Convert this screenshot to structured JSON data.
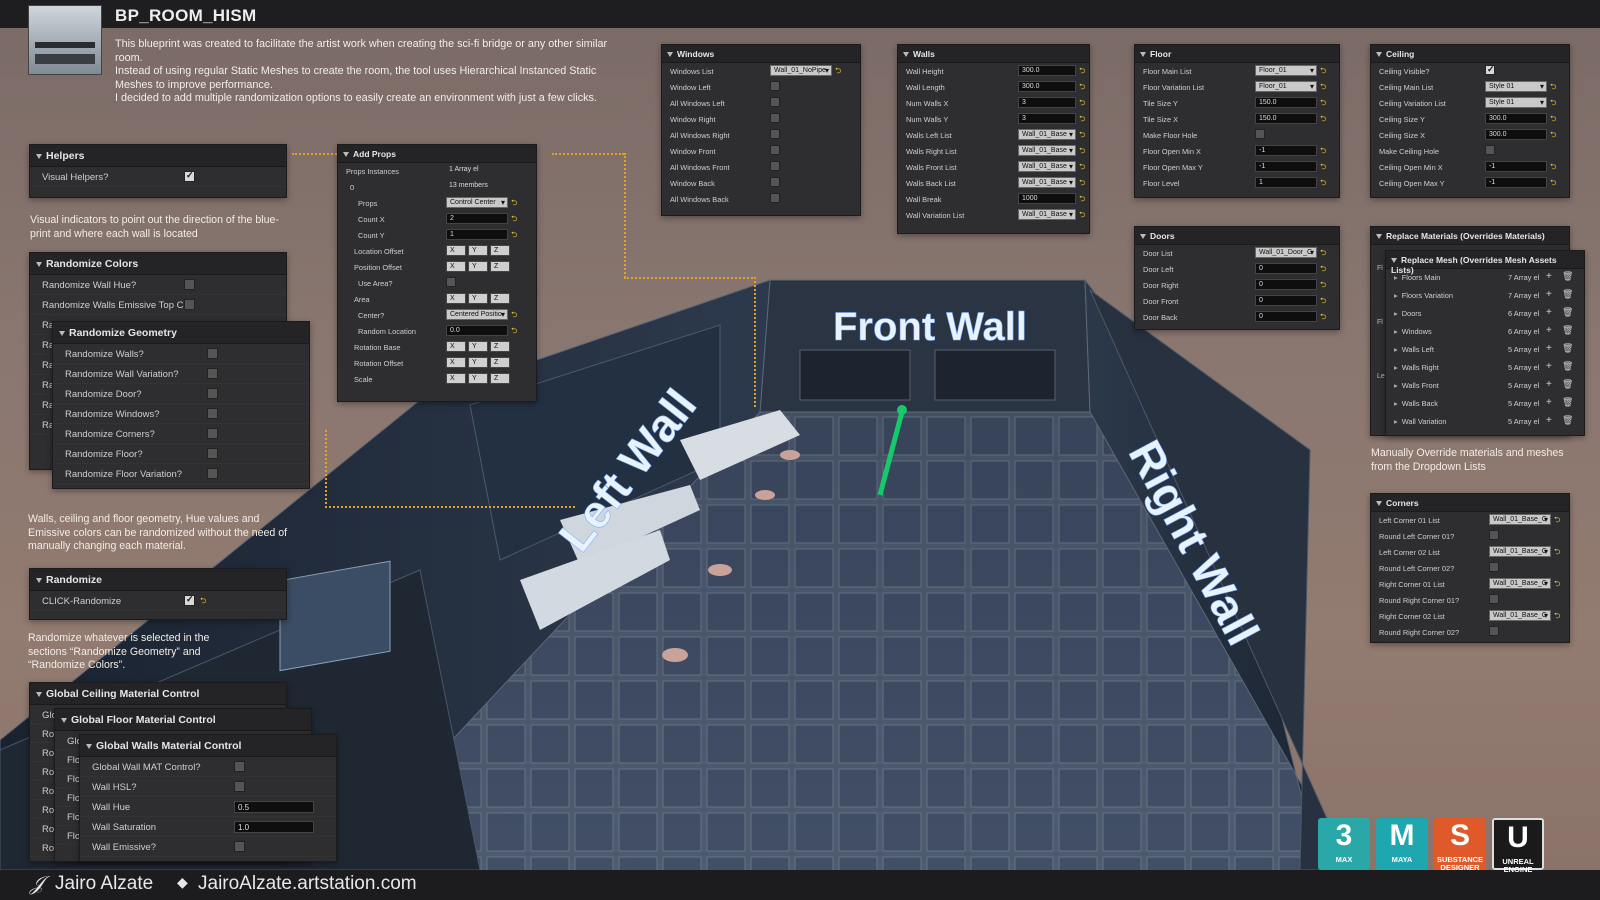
{
  "title": "BP_ROOM_HISM",
  "description": [
    "This blueprint was created to facilitate the artist work when creating the sci-fi bridge or any other similar room.",
    "Instead of using regular Static Meshes to create the room, the tool uses Hierarchical Instanced Static Meshes to improve performance.",
    "I decided to add multiple randomization options to easily create an environment with just a few clicks."
  ],
  "helpers": {
    "title": "Helpers",
    "rows": [
      {
        "label": "Visual Helpers?",
        "checked": true
      }
    ],
    "note": "Visual indicators to point out the direction of the blue-print and where each wall is located"
  },
  "randomize_colors": {
    "title": "Randomize Colors",
    "rows": [
      {
        "label": "Randomize Wall Hue?"
      },
      {
        "label": "Randomize Walls Emissive Top C"
      }
    ]
  },
  "randomize_geometry": {
    "title": "Randomize Geometry",
    "rows": [
      {
        "label": "Randomize Walls?"
      },
      {
        "label": "Randomize Wall Variation?"
      },
      {
        "label": "Randomize Door?"
      },
      {
        "label": "Randomize Windows?"
      },
      {
        "label": "Randomize Corners?"
      },
      {
        "label": "Randomize Floor?"
      },
      {
        "label": "Randomize Floor Variation?"
      }
    ],
    "behind_labels": [
      "Ra",
      "Ra",
      "Ra",
      "Ra",
      "Ra",
      "Ra"
    ]
  },
  "geometry_note": "Walls, ceiling and floor geometry, Hue values and Emissive colors can be randomized without the need of manually changing each material.",
  "randomize": {
    "title": "Randomize",
    "rows": [
      {
        "label": "CLICK-Randomize",
        "checked": true
      }
    ],
    "note": "Randomize whatever is selected in the sections “Randomize Geometry” and “Randomize Colors”."
  },
  "global_ceiling": {
    "title": "Global Ceiling Material Control",
    "behind_labels": [
      "Glo",
      "Ro",
      "Ro",
      "Ro",
      "Ro",
      "Ro",
      "Ro",
      "Ro"
    ]
  },
  "global_floor": {
    "title": "Global Floor Material Control",
    "behind_labels": [
      "Glo",
      "Flo",
      "Flo",
      "Flo",
      "Flo",
      "Flo"
    ]
  },
  "global_walls": {
    "title": "Global Walls Material Control",
    "rows": [
      {
        "label": "Global Wall MAT Control?",
        "type": "check"
      },
      {
        "label": "Wall HSL?",
        "type": "check"
      },
      {
        "label": "Wall Hue",
        "type": "num",
        "value": "0.5"
      },
      {
        "label": "Wall Saturation",
        "type": "num",
        "value": "1.0"
      },
      {
        "label": "Wall Emissive?",
        "type": "check"
      }
    ]
  },
  "add_props": {
    "title": "Add Props",
    "rows": [
      {
        "label": "Props Instances",
        "value": "1 Array el",
        "type": "array"
      },
      {
        "label": "0",
        "value": "13 members",
        "type": "members"
      },
      {
        "label": "Props",
        "value": "Control Center",
        "type": "dd"
      },
      {
        "label": "Count X",
        "value": "2",
        "type": "num"
      },
      {
        "label": "Count Y",
        "value": "1",
        "type": "num"
      },
      {
        "label": "Location Offset",
        "type": "xyz"
      },
      {
        "label": "Position Offset",
        "type": "xyz"
      },
      {
        "label": "Use Area?",
        "type": "check"
      },
      {
        "label": "Area",
        "type": "xyz"
      },
      {
        "label": "Center?",
        "value": "Centered Positio",
        "type": "dd"
      },
      {
        "label": "Random Location",
        "value": "0.0",
        "type": "num"
      },
      {
        "label": "Rotation Base",
        "type": "xyz"
      },
      {
        "label": "Rotation Offset",
        "type": "xyz"
      },
      {
        "label": "Scale",
        "type": "xyz"
      }
    ]
  },
  "windows": {
    "title": "Windows",
    "rows": [
      {
        "label": "Windows List",
        "value": "Wall_01_NoPipe",
        "type": "dd"
      },
      {
        "label": "Window Left"
      },
      {
        "label": "All Windows Left"
      },
      {
        "label": "Window Right"
      },
      {
        "label": "All Windows Right"
      },
      {
        "label": "Window Front"
      },
      {
        "label": "All Windows Front"
      },
      {
        "label": "Window Back"
      },
      {
        "label": "All Windows Back"
      }
    ]
  },
  "walls": {
    "title": "Walls",
    "rows": [
      {
        "label": "Wall Height",
        "value": "300.0",
        "type": "num"
      },
      {
        "label": "Wall Length",
        "value": "300.0",
        "type": "num"
      },
      {
        "label": "Num Walls X",
        "value": "3",
        "type": "num"
      },
      {
        "label": "Num Walls Y",
        "value": "3",
        "type": "num"
      },
      {
        "label": "Walls Left List",
        "value": "Wall_01_Base",
        "type": "dd"
      },
      {
        "label": "Walls Right List",
        "value": "Wall_01_Base",
        "type": "dd"
      },
      {
        "label": "Walls Front List",
        "value": "Wall_01_Base",
        "type": "dd"
      },
      {
        "label": "Walls Back List",
        "value": "Wall_01_Base",
        "type": "dd"
      },
      {
        "label": "Wall Break",
        "value": "1000",
        "type": "num"
      },
      {
        "label": "Wall Variation List",
        "value": "Wall_01_Base",
        "type": "dd"
      }
    ]
  },
  "floor": {
    "title": "Floor",
    "rows": [
      {
        "label": "Floor Main List",
        "value": "Floor_01",
        "type": "dd"
      },
      {
        "label": "Floor Variation List",
        "value": "Floor_01",
        "type": "dd"
      },
      {
        "label": "Tile Size Y",
        "value": "150.0",
        "type": "num"
      },
      {
        "label": "Tile Size X",
        "value": "150.0",
        "type": "num"
      },
      {
        "label": "Make Floor Hole",
        "type": "check"
      },
      {
        "label": "Floor Open Min X",
        "value": "-1",
        "type": "num"
      },
      {
        "label": "Floor Open Max Y",
        "value": "-1",
        "type": "num"
      },
      {
        "label": "Floor Level",
        "value": "1",
        "type": "num"
      }
    ]
  },
  "doors": {
    "title": "Doors",
    "rows": [
      {
        "label": "Door List",
        "value": "Wall_01_Door_C",
        "type": "dd"
      },
      {
        "label": "Door Left",
        "value": "0",
        "type": "num"
      },
      {
        "label": "Door Right",
        "value": "0",
        "type": "num"
      },
      {
        "label": "Door Front",
        "value": "0",
        "type": "num"
      },
      {
        "label": "Door Back",
        "value": "0",
        "type": "num"
      }
    ]
  },
  "ceiling": {
    "title": "Ceiling",
    "rows": [
      {
        "label": "Ceiling Visible?",
        "type": "check",
        "checked": true
      },
      {
        "label": "Ceiling Main List",
        "value": "Style 01",
        "type": "dd"
      },
      {
        "label": "Ceiling Variation List",
        "value": "Style 01",
        "type": "dd"
      },
      {
        "label": "Ceiling Size Y",
        "value": "300.0",
        "type": "num"
      },
      {
        "label": "Ceiling Size X",
        "value": "300.0",
        "type": "num"
      },
      {
        "label": "Make Ceiling Hole",
        "type": "check"
      },
      {
        "label": "Ceiling Open Min X",
        "value": "-1",
        "type": "num"
      },
      {
        "label": "Ceiling Open Max Y",
        "value": "-1",
        "type": "num"
      }
    ]
  },
  "replace_materials": {
    "title": "Replace Materials (Overrides Materials)"
  },
  "replace_mesh": {
    "title": "Replace Mesh (Overrides Mesh Assets Lists)",
    "rows": [
      {
        "label": "Floors Main",
        "value": "7 Array el"
      },
      {
        "label": "Floors Variation",
        "value": "7 Array el"
      },
      {
        "label": "Doors",
        "value": "6 Array el"
      },
      {
        "label": "Windows",
        "value": "6 Array el"
      },
      {
        "label": "Walls Left",
        "value": "5 Array el"
      },
      {
        "label": "Walls Right",
        "value": "5 Array el"
      },
      {
        "label": "Walls Front",
        "value": "5 Array el"
      },
      {
        "label": "Walls Back",
        "value": "5 Array el"
      },
      {
        "label": "Wall Variation",
        "value": "5 Array el"
      }
    ],
    "behind_labels": [
      "Fl",
      "Fl",
      "Le"
    ]
  },
  "replace_note": "Manually Override materials and meshes from the Dropdown Lists",
  "corners": {
    "title": "Corners",
    "rows": [
      {
        "label": "Left Corner 01 List",
        "value": "Wall_01_Base_C",
        "type": "dd"
      },
      {
        "label": "Round Left Corner 01?",
        "type": "check"
      },
      {
        "label": "Left Corner 02 List",
        "value": "Wall_01_Base_C",
        "type": "dd"
      },
      {
        "label": "Round Left Corner 02?",
        "type": "check"
      },
      {
        "label": "Right Corner 01 List",
        "value": "Wall_01_Base_C",
        "type": "dd"
      },
      {
        "label": "Round Right Corner 01?",
        "type": "check"
      },
      {
        "label": "Right Corner 02 List",
        "value": "Wall_01_Base_C",
        "type": "dd"
      },
      {
        "label": "Round Right Corner 02?",
        "type": "check"
      }
    ]
  },
  "scene": {
    "front_wall": "Front Wall",
    "left_wall": "Left Wall",
    "right_wall": "Right Wall"
  },
  "xyz": [
    "X",
    "Y",
    "Z"
  ],
  "footer": {
    "author": "Jairo Alzate",
    "site": "JairoAlzate.artstation.com"
  },
  "logos": [
    {
      "name": "3ds-max-logo",
      "big": "3",
      "small": "MAX",
      "color": "#2aa7a8"
    },
    {
      "name": "maya-logo",
      "big": "M",
      "small": "MAYA",
      "color": "#1fa7b0"
    },
    {
      "name": "substance-designer-logo",
      "big": "S",
      "small": "SUBSTANCE DESIGNER",
      "color": "#e0592b"
    },
    {
      "name": "unreal-engine-logo",
      "big": "U",
      "small": "UNREAL ENGINE",
      "color": "#1a1a1a"
    }
  ]
}
